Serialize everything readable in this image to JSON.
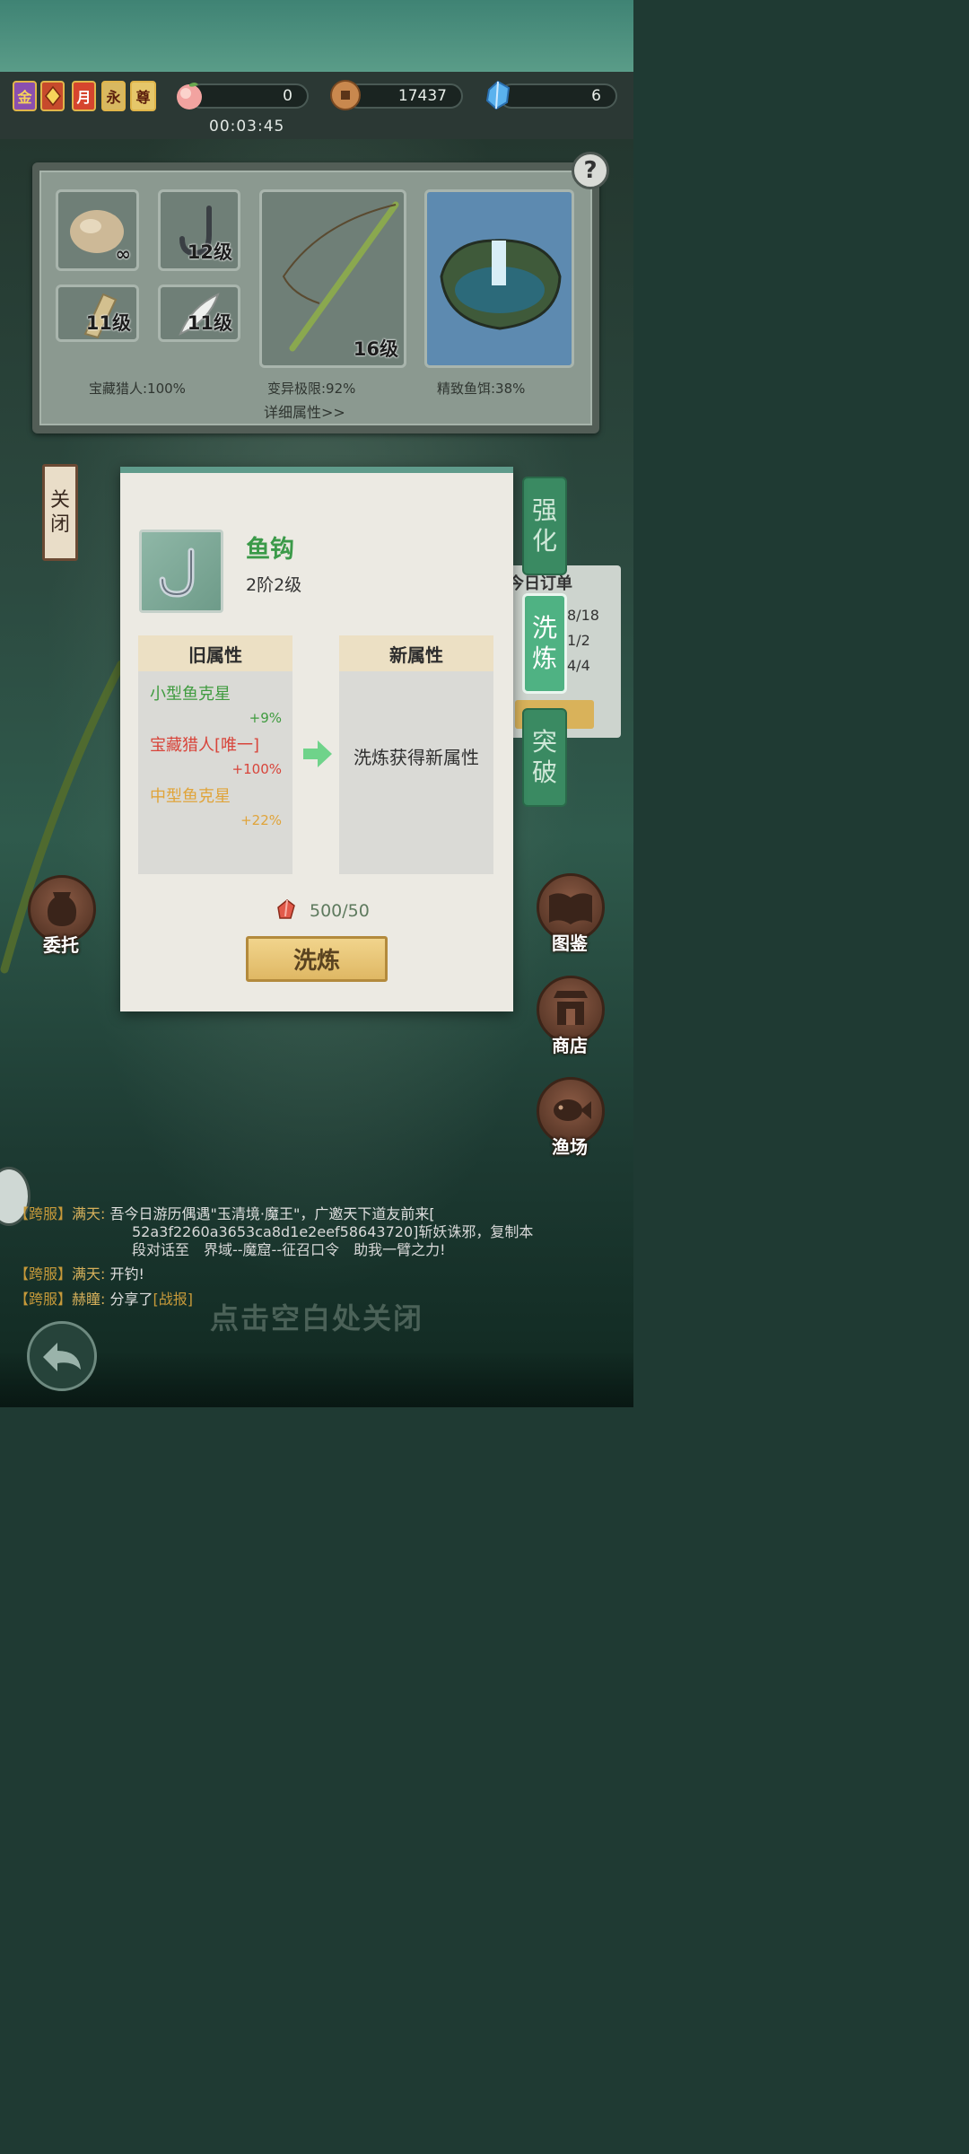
{
  "resources": {
    "badges": [
      "金",
      "",
      "月",
      "永",
      "尊"
    ],
    "peach_value": "0",
    "coin_value": "17437",
    "gem_value": "6",
    "timer": "00:03:45"
  },
  "equipment": {
    "slots": [
      {
        "name": "bait",
        "level": "∞"
      },
      {
        "name": "hook",
        "level": "12级"
      },
      {
        "name": "line",
        "level": "11级"
      },
      {
        "name": "float",
        "level": "11级"
      },
      {
        "name": "rod",
        "level": "16级"
      }
    ],
    "stats": [
      "宝藏猎人:100%",
      "变异极限:92%",
      "精致鱼饵:38%"
    ],
    "detail_link": "详细属性>>",
    "help": "?"
  },
  "close_tag": [
    "关",
    "闭"
  ],
  "side_tabs": [
    {
      "line1": "强",
      "line2": "化"
    },
    {
      "line1": "洗",
      "line2": "炼"
    },
    {
      "line1": "突",
      "line2": "破"
    }
  ],
  "order_panel": {
    "title": "今日订单",
    "rows": [
      "8/18",
      "1/2",
      "4/4"
    ]
  },
  "modal": {
    "item_name": "鱼钩",
    "item_level": "2阶2级",
    "old_header": "旧属性",
    "new_header": "新属性",
    "old_attrs": [
      {
        "name": "小型鱼克星",
        "value": "+9%",
        "color": "#3f9b3f"
      },
      {
        "name": "宝藏猎人[唯一]",
        "value": "+100%",
        "color": "#d8443a"
      },
      {
        "name": "中型鱼克星",
        "value": "+22%",
        "color": "#e0a43a"
      }
    ],
    "new_attr_text": "洗炼获得新属性",
    "cost": "500/50",
    "button": "洗炼"
  },
  "round_buttons": {
    "commission": "委托",
    "atlas": "图鉴",
    "shop": "商店",
    "fishing_ground": "渔场"
  },
  "chat": [
    {
      "tag": "【跨服】",
      "user": "满天:",
      "text": "吾今日游历偶遇\"玉清境·魔王\"，广邀天下道友前来[",
      "line2": "52a3f2260a3653ca8d1e2eef58643720]斩妖诛邪，复制本",
      "line3": "段对话至　界域--魔窟--征召口令　助我一臂之力!"
    },
    {
      "tag": "【跨服】",
      "user": "满天:",
      "text": "开钓!"
    },
    {
      "tag": "【跨服】",
      "user": "赫瞳:",
      "text": "分享了",
      "link": "[战报]"
    }
  ],
  "hint": "点击空白处关闭"
}
